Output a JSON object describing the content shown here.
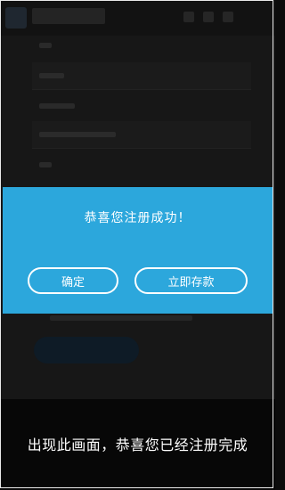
{
  "modal": {
    "message": "恭喜您注册成功！",
    "confirm_label": "确定",
    "deposit_label": "立即存款"
  },
  "caption": {
    "text": "出现此画面，恭喜您已经注册完成"
  },
  "colors": {
    "modal_bg": "#2ca7dc",
    "page_bg": "#0c0c0c"
  }
}
